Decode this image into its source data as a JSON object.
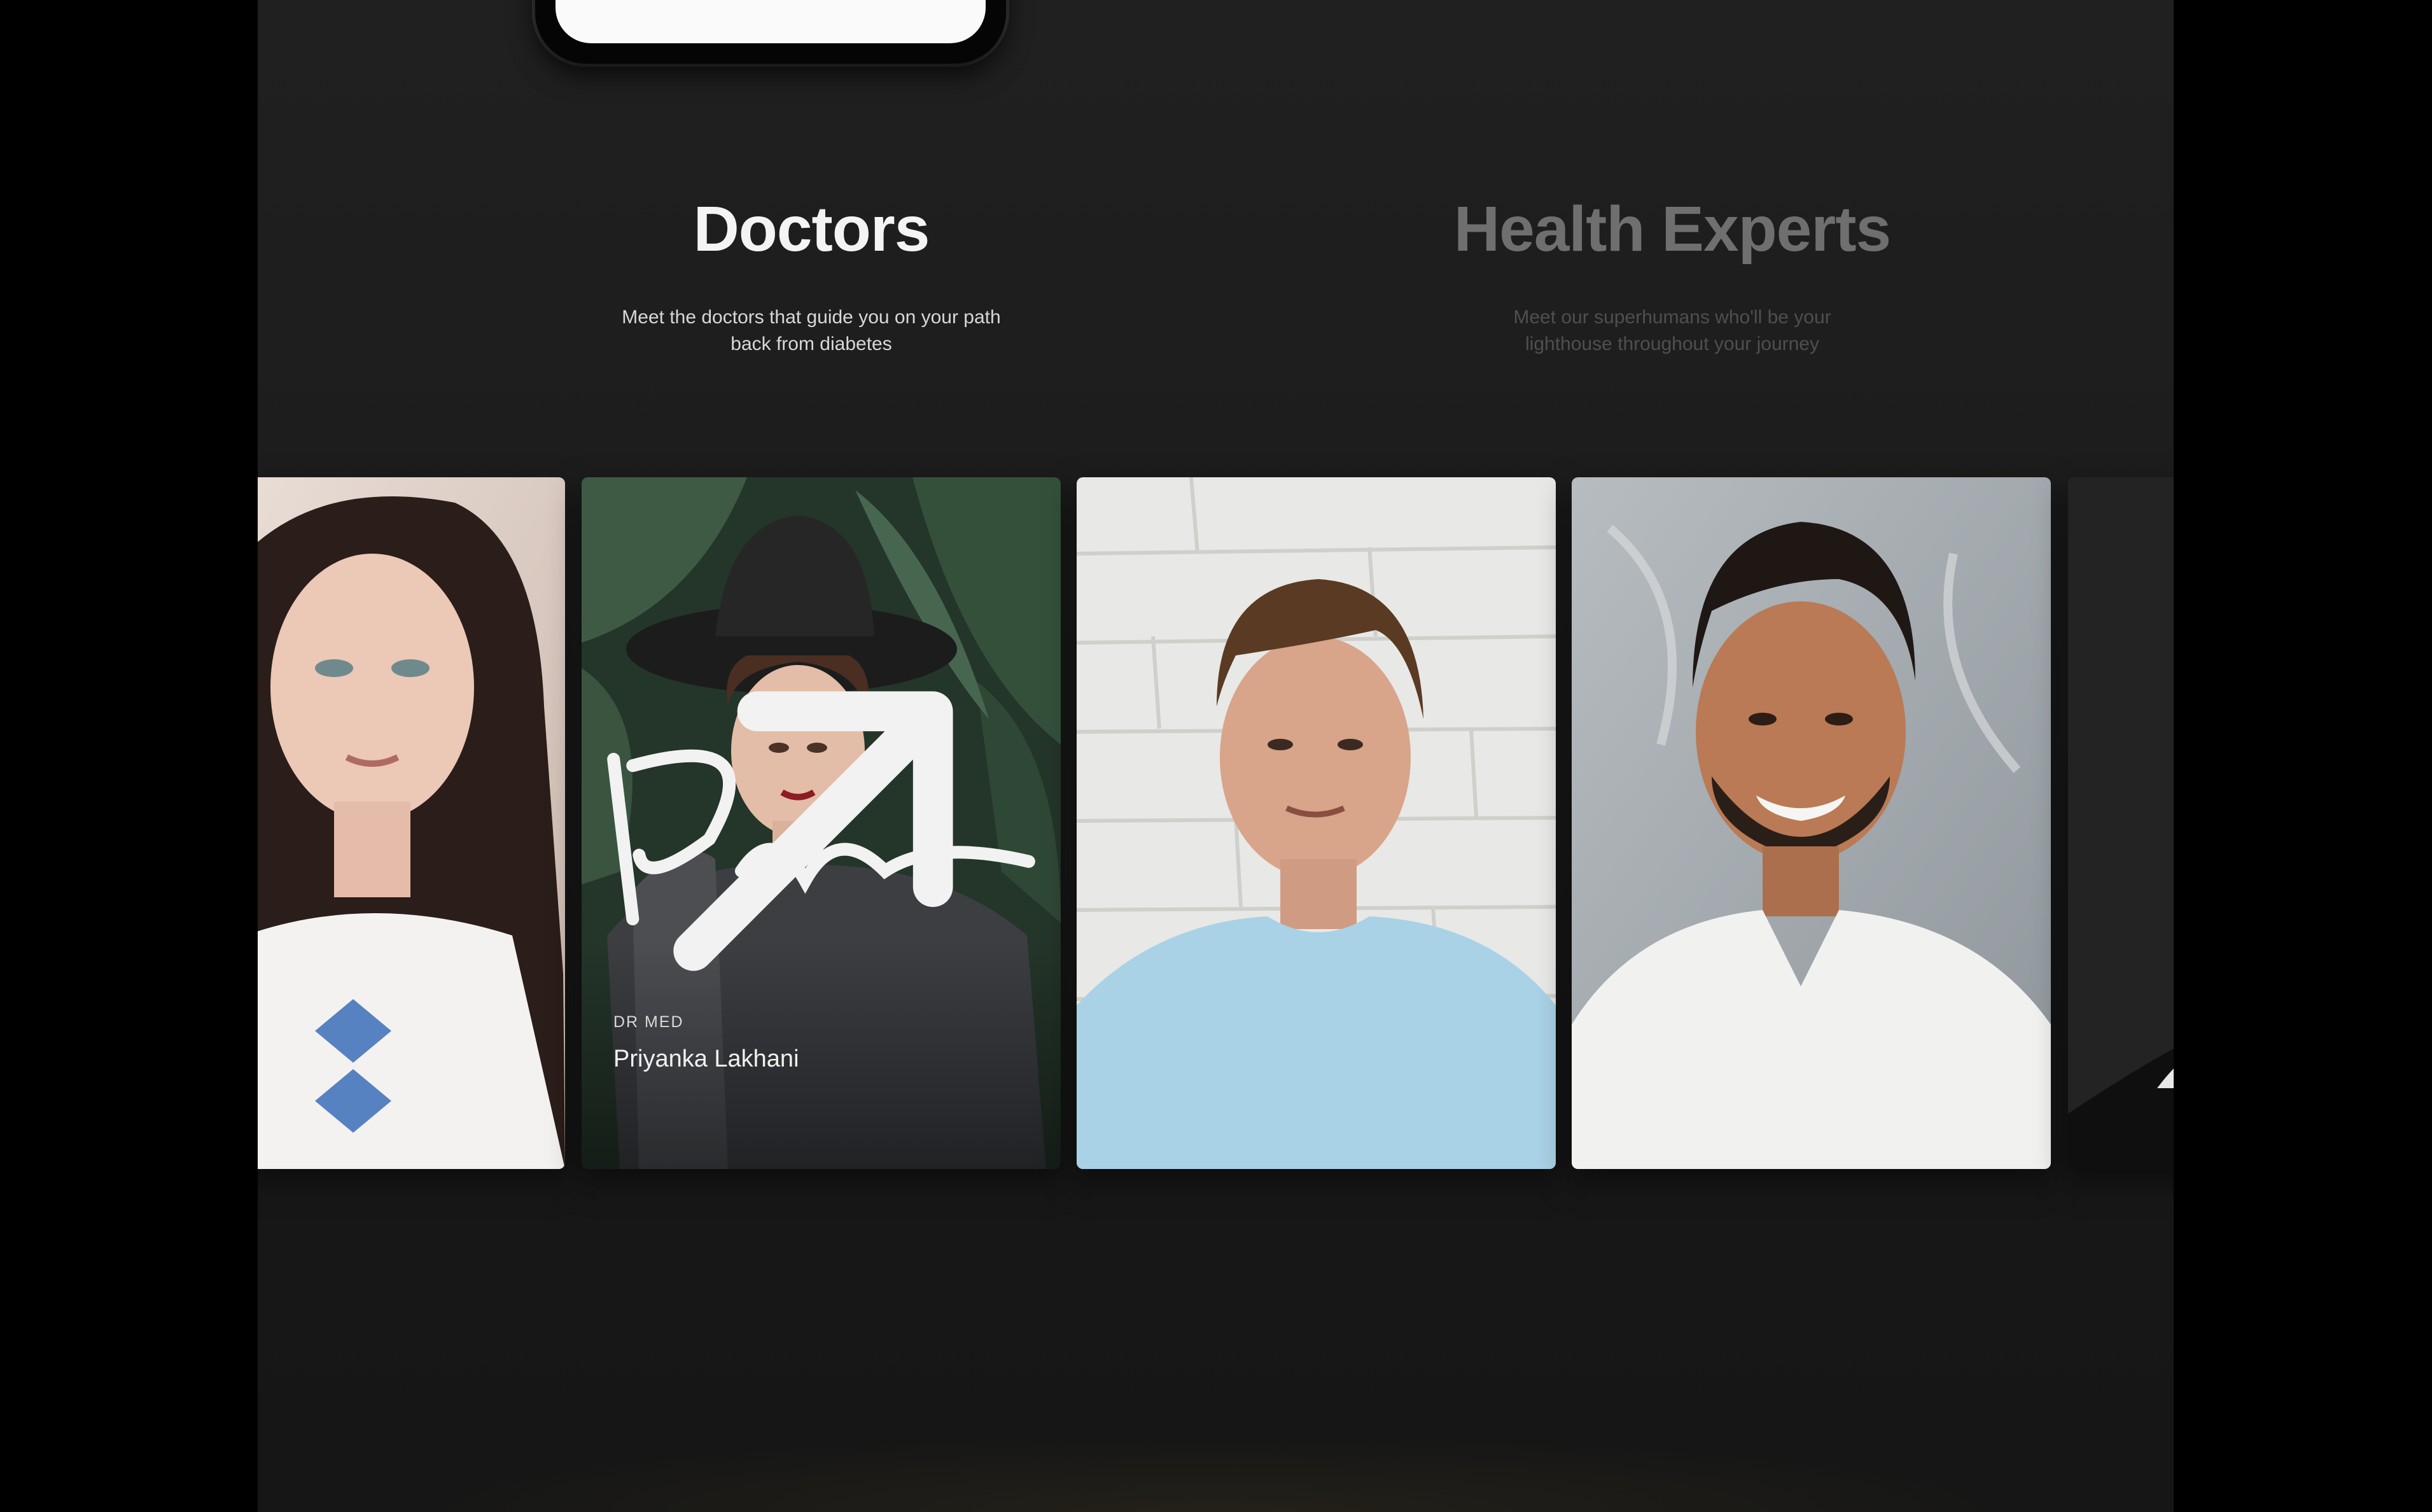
{
  "tabs": [
    {
      "label": "Doctors",
      "description": "Meet the doctors that guide you on your path back from diabetes",
      "active": true
    },
    {
      "label": "Health Experts",
      "description": "Meet our superhumans who'll be your lighthouse throughout your journey",
      "active": false
    }
  ],
  "featured_doctor": {
    "title": "DR MED",
    "name": "Priyanka Lakhani"
  },
  "icons": {
    "signature": "signature-icon",
    "open": "arrow-up-right-icon"
  },
  "colors": {
    "background": "#1b1b1b",
    "active_tab": "#f4f4f4",
    "inactive_tab": "#6f6f6f"
  }
}
